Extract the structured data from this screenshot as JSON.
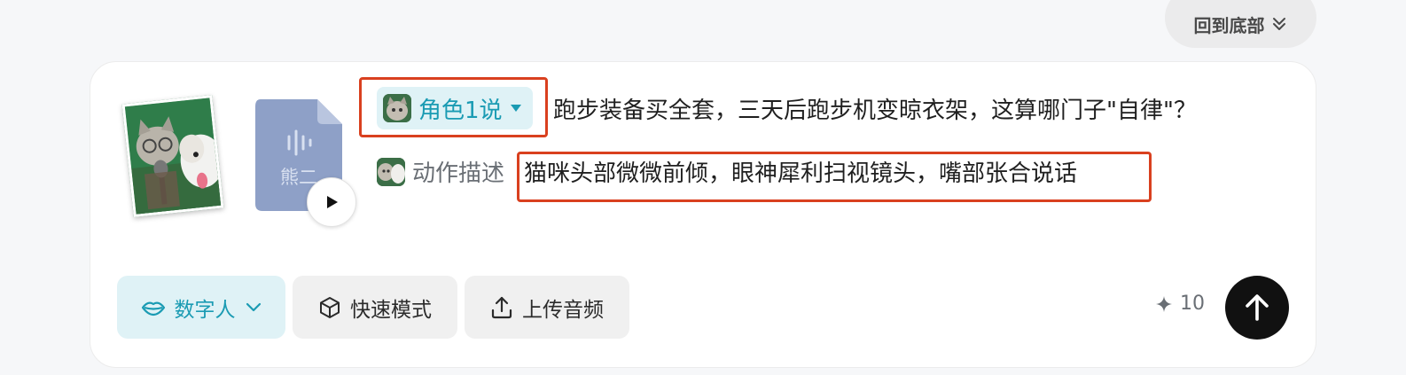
{
  "back_to_bottom": {
    "label": "回到底部"
  },
  "thumbnails": {
    "audio_label": "熊二"
  },
  "role": {
    "label": "角色1说"
  },
  "script_line": "跑步装备买全套，三天后跑步机变晾衣架，这算哪门子\"自律\"？",
  "action": {
    "label": "动作描述",
    "description": "猫咪头部微微前倾，眼神犀利扫视镜头，嘴部张合说话"
  },
  "toolbar": {
    "digital_human": "数字人",
    "fast_mode": "快速模式",
    "upload_audio": "上传音频"
  },
  "credits": {
    "value": "10"
  },
  "colors": {
    "accent": "#1a9bb3",
    "accent_bg": "#dff2f6",
    "highlight": "#d9401f",
    "send": "#111111"
  }
}
